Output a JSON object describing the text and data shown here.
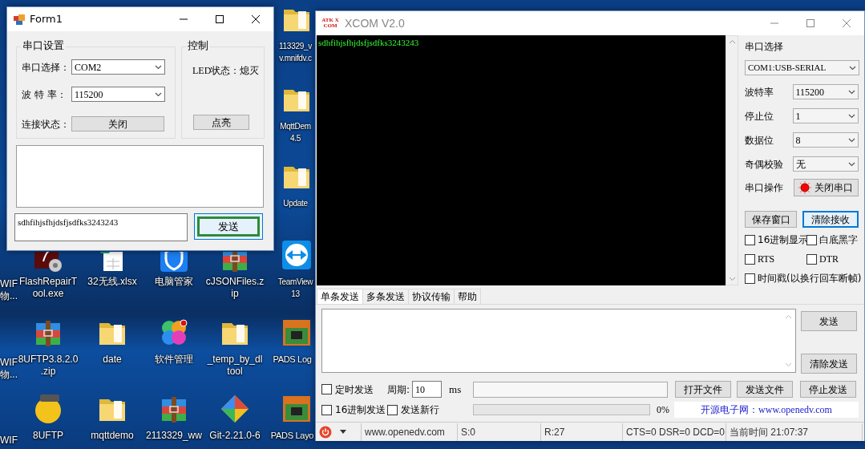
{
  "desktop": {
    "icons": [
      {
        "kind": "folder",
        "lines": [
          "113329_v",
          "v.mnifdv.c"
        ]
      },
      {
        "kind": "folder",
        "lines": [
          "MqttDem",
          "4.5"
        ]
      },
      {
        "kind": "folder",
        "lines": [
          "Update"
        ]
      },
      {
        "lines": [
          "WIF",
          "物..."
        ]
      },
      {
        "kind": "flash",
        "lines": [
          "FlashRepairT",
          "ool.exe"
        ]
      },
      {
        "kind": "sheet",
        "lines": [
          "32无线.xlsx"
        ]
      },
      {
        "kind": "shield",
        "lines": [
          "电脑管家"
        ]
      },
      {
        "kind": "archive",
        "lines": [
          "cJSONFiles.z",
          "ip"
        ]
      },
      {
        "kind": "remote",
        "lines": [
          "TeamView",
          "13"
        ]
      },
      {
        "lines": [
          "WIF",
          "物..."
        ]
      },
      {
        "kind": "archive",
        "lines": [
          "8UFTP3.8.2.0",
          ".zip"
        ]
      },
      {
        "kind": "folder",
        "lines": [
          "date"
        ]
      },
      {
        "kind": "clover",
        "lines": [
          "软件管理"
        ]
      },
      {
        "kind": "folder",
        "lines": [
          "_temp_by_dl",
          "tool"
        ]
      },
      {
        "kind": "pads",
        "lines": [
          "PADS Log"
        ]
      },
      {
        "lines": [
          "WIF"
        ]
      },
      {
        "kind": "ftp",
        "lines": [
          "8UFTP"
        ]
      },
      {
        "kind": "folder",
        "lines": [
          "mqttdemo"
        ]
      },
      {
        "kind": "archive",
        "lines": [
          "2113329_ww"
        ]
      },
      {
        "kind": "git",
        "lines": [
          "Git-2.21.0-6"
        ]
      },
      {
        "kind": "pads",
        "lines": [
          "PADS Layo"
        ]
      }
    ]
  },
  "form1": {
    "title": "Form1",
    "serial_group": {
      "title": "串口设置",
      "port_label": "串口选择：",
      "port_value": "COM2",
      "baud_label": "波 特 率：",
      "baud_value": "115200",
      "status_label": "连接状态：",
      "toggle_button": "关闭"
    },
    "control_group": {
      "title": "控制",
      "led_label": "LED状态：",
      "led_value": "熄灭",
      "light_button": "点亮"
    },
    "send_input": {
      "value": "sdhfihjsfhjdsfjsdfks3243243"
    },
    "send_button": {
      "label": "发送",
      "focused": true
    }
  },
  "xcom": {
    "logo": "ATK XCOM",
    "title": "XCOM V2.0",
    "receive": {
      "lines": [
        "sdhfihjsfhjdsfjsdfks3243243"
      ]
    },
    "settings": {
      "title": "串口选择",
      "port": "COM1:USB-SERIAL",
      "fields": [
        {
          "label": "波特率",
          "value": "115200"
        },
        {
          "label": "停止位",
          "value": "1"
        },
        {
          "label": "数据位",
          "value": "8"
        },
        {
          "label": "奇偶校验",
          "value": "无"
        }
      ],
      "operation_label": "串口操作",
      "open_button": {
        "label": "关闭串口",
        "port_open": true
      }
    },
    "buttons": [
      {
        "label": "保存窗口",
        "focused": false
      },
      {
        "label": "清除接收",
        "focused": true
      }
    ],
    "options": [
      {
        "label": "16进制显示",
        "checked": false
      },
      {
        "label": "白底黑字",
        "checked": false
      },
      {
        "label": "RTS",
        "checked": false
      },
      {
        "label": "DTR",
        "checked": false
      },
      {
        "label": "时间戳(以换行回车断帧)",
        "checked": false
      }
    ],
    "tabs": [
      {
        "label": "单条发送",
        "selected": true
      },
      {
        "label": "多条发送",
        "selected": false
      },
      {
        "label": "协议传输",
        "selected": false
      },
      {
        "label": "帮助",
        "selected": false
      }
    ],
    "send_buttons": [
      "发送",
      "清除发送"
    ],
    "timed_send": {
      "label": "定时发送",
      "checked": false
    },
    "period_label": "周期:",
    "period_value": "10",
    "period_unit": "ms",
    "file_buttons": [
      "打开文件",
      "发送文件",
      "停止发送"
    ],
    "hex_send": {
      "label": "16进制发送",
      "checked": false
    },
    "new_line": {
      "label": "发送新行",
      "checked": false
    },
    "progress": {
      "level": 0,
      "reading": "0%"
    },
    "ad": "开源电子网：www.openedv.com",
    "status_bar": {
      "site": "www.openedv.com",
      "sent": "S:0",
      "received": "R:27",
      "lines": "CTS=0 DSR=0 DCD=0",
      "time": "当前时间 21:07:37"
    }
  }
}
